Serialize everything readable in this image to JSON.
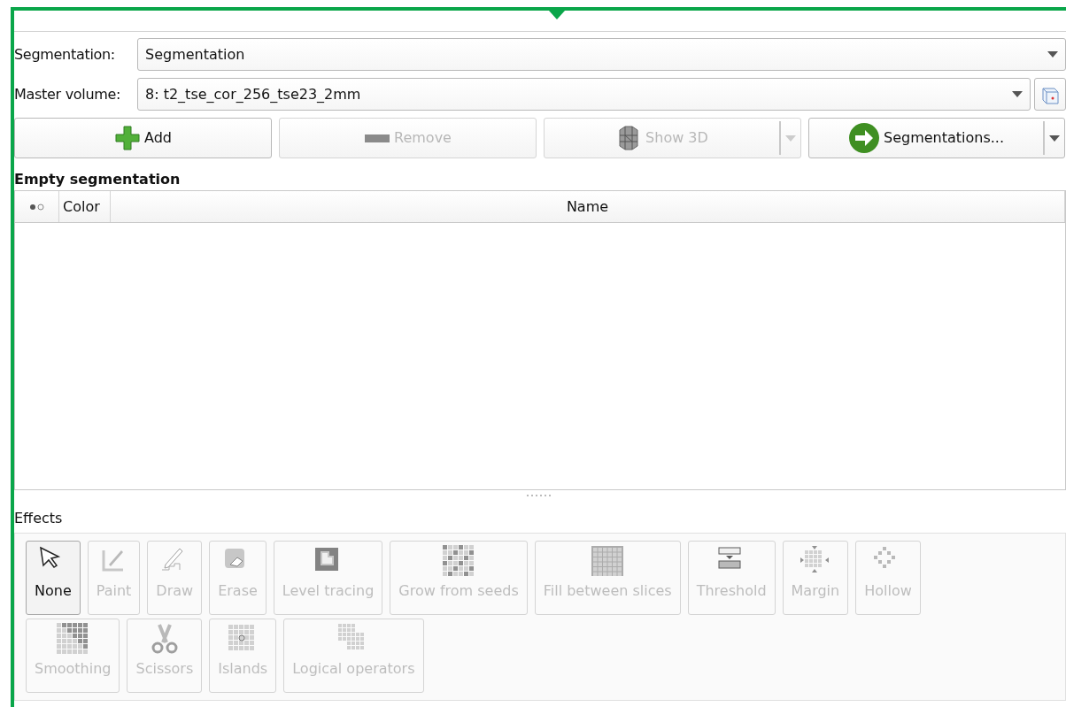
{
  "segmentation_selector": {
    "label": "Segmentation:",
    "value": "Segmentation"
  },
  "master_volume_selector": {
    "label": "Master volume:",
    "value": "8: t2_tse_cor_256_tse23_2mm"
  },
  "actions": [
    {
      "label": "Add",
      "kind": "add",
      "disabled": false,
      "dropdown": false
    },
    {
      "label": "Remove",
      "kind": "remove",
      "disabled": true,
      "dropdown": false
    },
    {
      "label": "Show 3D",
      "kind": "show3d",
      "disabled": true,
      "dropdown": true
    },
    {
      "label": "Segmentations...",
      "kind": "segmentations",
      "disabled": false,
      "dropdown": true
    }
  ],
  "segments_title": "Empty segmentation",
  "table": {
    "columns": [
      "Color",
      "Name"
    ]
  },
  "effects_label": "Effects",
  "effects": [
    [
      {
        "label": "None",
        "kind": "cursor",
        "selected": true,
        "disabled": false
      },
      {
        "label": "Paint",
        "kind": "brush",
        "selected": false,
        "disabled": true
      },
      {
        "label": "Draw",
        "kind": "pencil",
        "selected": false,
        "disabled": true
      },
      {
        "label": "Erase",
        "kind": "eraser",
        "selected": false,
        "disabled": true
      },
      {
        "label": "Level tracing",
        "kind": "trace",
        "selected": false,
        "disabled": true
      },
      {
        "label": "Grow from seeds",
        "kind": "seeds",
        "selected": false,
        "disabled": true
      },
      {
        "label": "Fill between slices",
        "kind": "slices",
        "selected": false,
        "disabled": true
      },
      {
        "label": "Threshold",
        "kind": "threshold",
        "selected": false,
        "disabled": true
      },
      {
        "label": "Margin",
        "kind": "margin",
        "selected": false,
        "disabled": true
      },
      {
        "label": "Hollow",
        "kind": "hollow",
        "selected": false,
        "disabled": true
      }
    ],
    [
      {
        "label": "Smoothing",
        "kind": "smoothing",
        "selected": false,
        "disabled": true
      },
      {
        "label": "Scissors",
        "kind": "scissors",
        "selected": false,
        "disabled": true
      },
      {
        "label": "Islands",
        "kind": "islands",
        "selected": false,
        "disabled": true
      },
      {
        "label": "Logical operators",
        "kind": "logical",
        "selected": false,
        "disabled": true
      }
    ]
  ]
}
